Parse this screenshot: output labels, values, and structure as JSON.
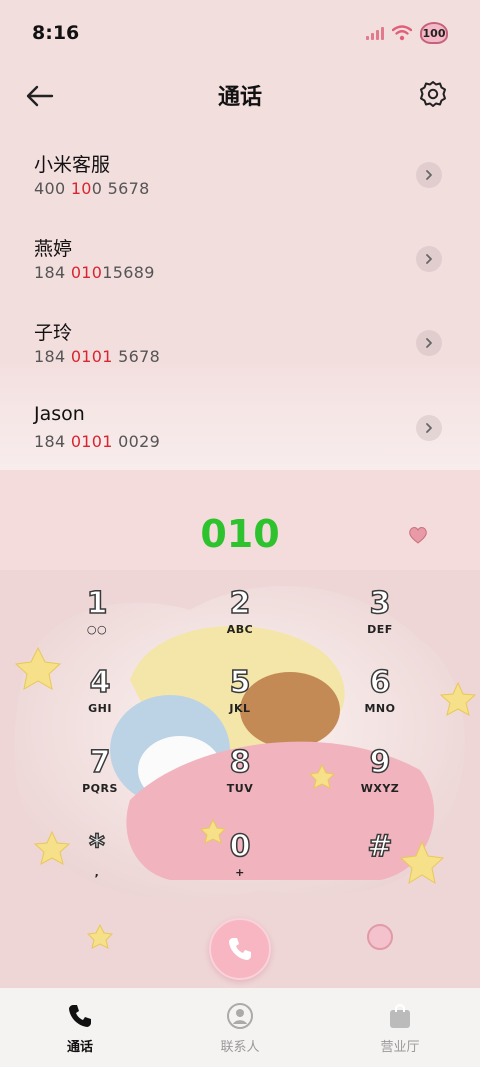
{
  "status_bar": {
    "time": "8:16",
    "battery": "100"
  },
  "header": {
    "title": "通话"
  },
  "contacts": [
    {
      "name": "小米客服",
      "number_parts": [
        "400 ",
        "10",
        "0 5678"
      ]
    },
    {
      "name": "燕婷",
      "number_parts": [
        "184 ",
        "010",
        "15689"
      ]
    },
    {
      "name": "子玲",
      "number_parts": [
        "184 ",
        "0101",
        " 5678"
      ]
    },
    {
      "name": "Jason",
      "number_parts": [
        "184 ",
        "0101",
        " 0029"
      ]
    }
  ],
  "dialer": {
    "number": "010",
    "keys": [
      {
        "digit": "1",
        "letters": ""
      },
      {
        "digit": "2",
        "letters": "ABC"
      },
      {
        "digit": "3",
        "letters": "DEF"
      },
      {
        "digit": "4",
        "letters": "GHI"
      },
      {
        "digit": "5",
        "letters": "JKL"
      },
      {
        "digit": "6",
        "letters": "MNO"
      },
      {
        "digit": "7",
        "letters": "PQRS"
      },
      {
        "digit": "8",
        "letters": "TUV"
      },
      {
        "digit": "9",
        "letters": "WXYZ"
      },
      {
        "digit": "*",
        "letters": ","
      },
      {
        "digit": "0",
        "letters": "+"
      },
      {
        "digit": "#",
        "letters": ""
      }
    ]
  },
  "bottom_nav": [
    {
      "label": "通话",
      "icon": "phone-icon",
      "active": true
    },
    {
      "label": "联系人",
      "icon": "contacts-icon",
      "active": false
    },
    {
      "label": "营业厅",
      "icon": "shop-bag-icon",
      "active": false
    }
  ],
  "colors": {
    "highlight": "#d9252f",
    "dial_number": "#2ec22e",
    "call_button": "#f8b6c2"
  }
}
